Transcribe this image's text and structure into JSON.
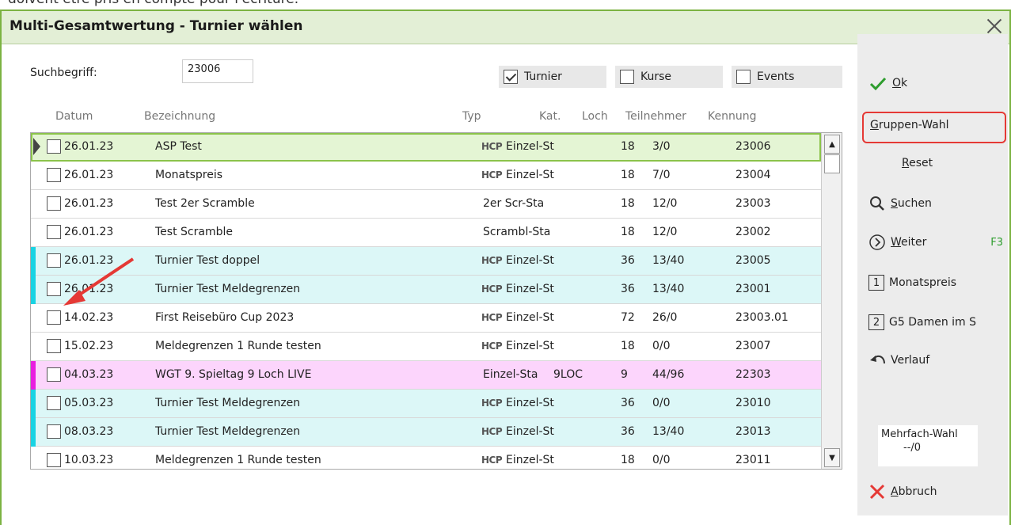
{
  "top_text": "doivent être pris en compte pour l'écriture.",
  "dialog": {
    "title": "Multi-Gesamtwertung - Turnier wählen"
  },
  "search": {
    "label": "Suchbegriff:",
    "value": "23006"
  },
  "filters": [
    {
      "label": "Turnier",
      "checked": true
    },
    {
      "label": "Kurse",
      "checked": false
    },
    {
      "label": "Events",
      "checked": false
    }
  ],
  "columns": [
    "Datum",
    "Bezeichnung",
    "Typ",
    "Kat.",
    "Loch",
    "Teilnehmer",
    "Kennung"
  ],
  "hcp_label": "HCP",
  "rows": [
    {
      "datum": "26.01.23",
      "bez": "ASP Test",
      "hcp": true,
      "typ": "Einzel-St",
      "kat": "",
      "loch": "18",
      "teil": "3/0",
      "kennung": "23006",
      "bg": "#e4f5d4",
      "marker": "triangle",
      "selected": true
    },
    {
      "datum": "26.01.23",
      "bez": "Monatspreis",
      "hcp": true,
      "typ": "Einzel-St",
      "kat": "",
      "loch": "18",
      "teil": "7/0",
      "kennung": "23004",
      "bg": "#ffffff",
      "marker": ""
    },
    {
      "datum": "26.01.23",
      "bez": "Test 2er Scramble",
      "hcp": false,
      "typ": "2er Scr-Sta",
      "kat": "",
      "loch": "18",
      "teil": "12/0",
      "kennung": "23003",
      "bg": "#ffffff",
      "marker": ""
    },
    {
      "datum": "26.01.23",
      "bez": "Test Scramble",
      "hcp": false,
      "typ": "Scrambl-Sta",
      "kat": "",
      "loch": "18",
      "teil": "12/0",
      "kennung": "23002",
      "bg": "#ffffff",
      "marker": ""
    },
    {
      "datum": "26.01.23",
      "bez": "Turnier Test doppel",
      "hcp": true,
      "typ": "Einzel-St",
      "kat": "",
      "loch": "36",
      "teil": "13/40",
      "kennung": "23005",
      "bg": "#dcf7f7",
      "marker": "#19d3e3"
    },
    {
      "datum": "26.01.23",
      "bez": "Turnier Test Meldegrenzen",
      "hcp": true,
      "typ": "Einzel-St",
      "kat": "",
      "loch": "36",
      "teil": "13/40",
      "kennung": "23001",
      "bg": "#dcf7f7",
      "marker": "#19d3e3"
    },
    {
      "datum": "14.02.23",
      "bez": "First Reisebüro Cup 2023",
      "hcp": true,
      "typ": "Einzel-St",
      "kat": "",
      "loch": "72",
      "teil": "26/0",
      "kennung": "23003.01",
      "bg": "#ffffff",
      "marker": ""
    },
    {
      "datum": "15.02.23",
      "bez": "Meldegrenzen 1 Runde testen",
      "hcp": true,
      "typ": "Einzel-St",
      "kat": "",
      "loch": "18",
      "teil": "0/0",
      "kennung": "23007",
      "bg": "#ffffff",
      "marker": ""
    },
    {
      "datum": "04.03.23",
      "bez": "WGT 9. Spieltag 9 Loch LIVE",
      "hcp": false,
      "typ": "Einzel-Sta",
      "kat": "9LOC",
      "loch": "9",
      "teil": "44/96",
      "kennung": "22303",
      "bg": "#fcd5fc",
      "marker": "#e91ee0"
    },
    {
      "datum": "05.03.23",
      "bez": "Turnier Test Meldegrenzen",
      "hcp": true,
      "typ": "Einzel-St",
      "kat": "",
      "loch": "36",
      "teil": "0/0",
      "kennung": "23010",
      "bg": "#dcf7f7",
      "marker": "#19d3e3"
    },
    {
      "datum": "08.03.23",
      "bez": "Turnier Test Meldegrenzen",
      "hcp": true,
      "typ": "Einzel-St",
      "kat": "",
      "loch": "36",
      "teil": "13/40",
      "kennung": "23013",
      "bg": "#dcf7f7",
      "marker": "#19d3e3"
    },
    {
      "datum": "10.03.23",
      "bez": "Meldegrenzen 1 Runde testen",
      "hcp": true,
      "typ": "Einzel-St",
      "kat": "",
      "loch": "18",
      "teil": "0/0",
      "kennung": "23011",
      "bg": "#ffffff",
      "marker": ""
    }
  ],
  "sidebar": {
    "ok": "Ok",
    "gruppen": "Gruppen-Wahl",
    "reset": "Reset",
    "suchen": "Suchen",
    "weiter": "Weiter",
    "weiter_key": "F3",
    "group1_num": "1",
    "group1": "Monatspreis",
    "group2_num": "2",
    "group2": "G5 Damen im S",
    "verlauf": "Verlauf",
    "mehrfach_label": "Mehrfach-Wahl",
    "mehrfach_value": "--/0",
    "abbruch": "Abbruch"
  },
  "colors": {
    "accent_green": "#7cb342",
    "highlight_red": "#e53935",
    "arrow_red": "#e53935"
  }
}
